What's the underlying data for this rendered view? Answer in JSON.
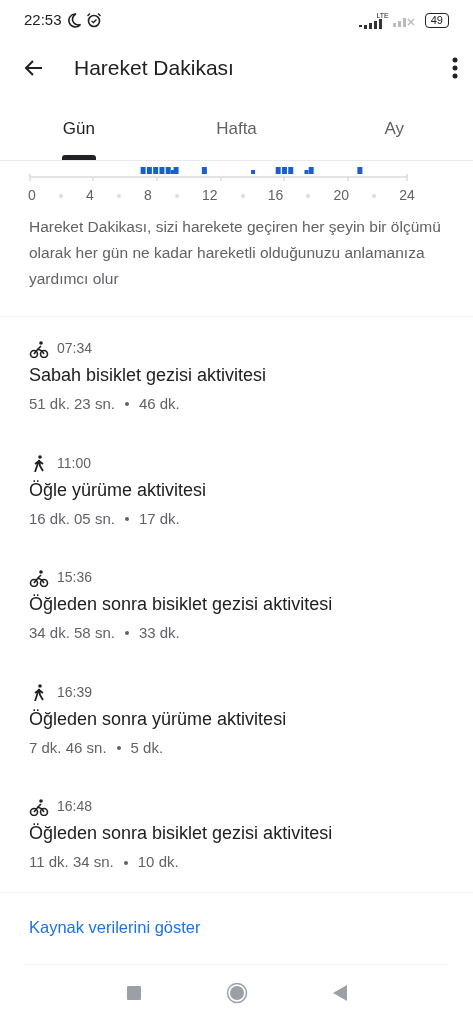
{
  "status_bar": {
    "time": "22:53",
    "network": "LTE",
    "battery": "49"
  },
  "app_bar": {
    "title": "Hareket Dakikası"
  },
  "tabs": [
    {
      "label": "Gün",
      "selected": true
    },
    {
      "label": "Hafta",
      "selected": false
    },
    {
      "label": "Ay",
      "selected": false
    }
  ],
  "axis_labels": [
    "0",
    "4",
    "8",
    "12",
    "16",
    "20",
    "24"
  ],
  "description": "Hareket Dakikası, sizi harekete geçiren her şeyin bir ölçümü olarak her gün ne kadar hareketli olduğunuzu anlamanıza yardımcı olur",
  "activities": [
    {
      "kind": "cycling",
      "time": "07:34",
      "title": "Sabah bisiklet gezisi aktivitesi",
      "duration": "51 dk. 23 sn.",
      "move_minutes": "46 dk."
    },
    {
      "kind": "walking",
      "time": "11:00",
      "title": "Öğle yürüme aktivitesi",
      "duration": "16 dk. 05 sn.",
      "move_minutes": "17 dk."
    },
    {
      "kind": "cycling",
      "time": "15:36",
      "title": "Öğleden sonra bisiklet gezisi aktivitesi",
      "duration": "34 dk. 58 sn.",
      "move_minutes": "33 dk."
    },
    {
      "kind": "walking",
      "time": "16:39",
      "title": "Öğleden sonra yürüme aktivitesi",
      "duration": "7 dk. 46 sn.",
      "move_minutes": "5 dk."
    },
    {
      "kind": "cycling",
      "time": "16:48",
      "title": "Öğleden sonra bisiklet gezisi aktivitesi",
      "duration": "11 dk. 34 sn.",
      "move_minutes": "10 dk."
    }
  ],
  "source_link": "Kaynak verilerini göster"
}
